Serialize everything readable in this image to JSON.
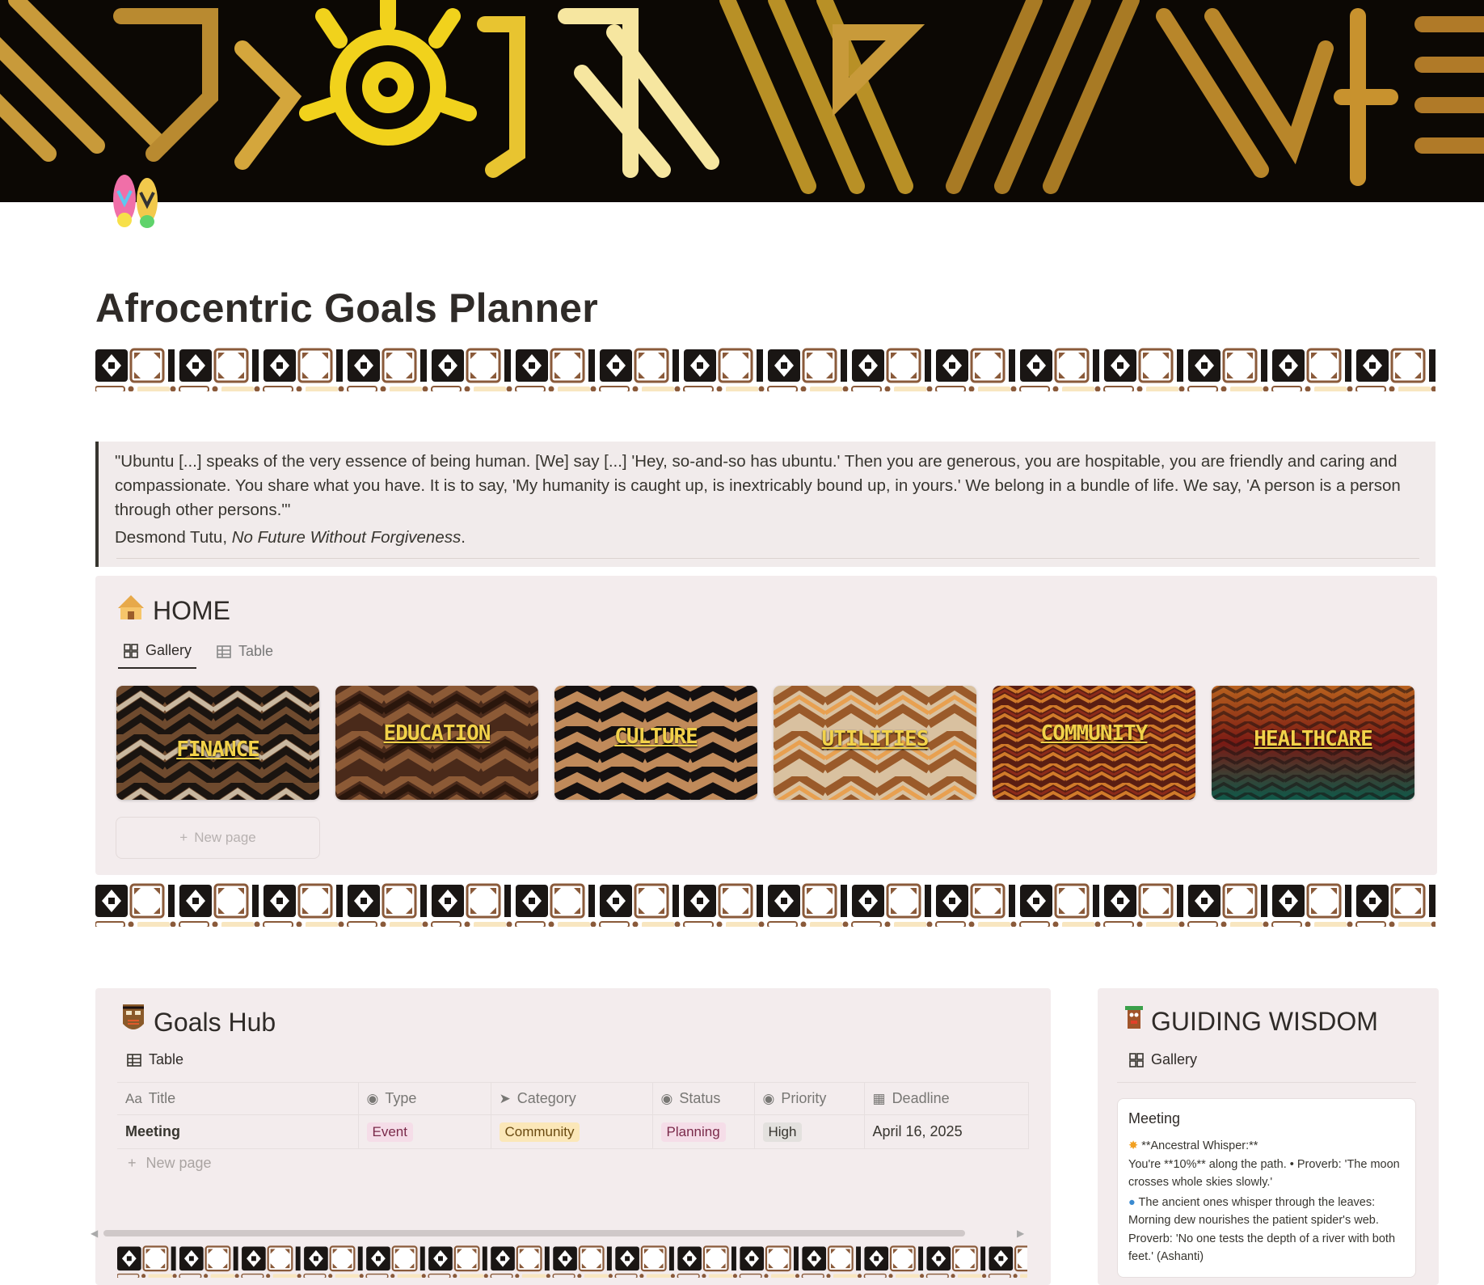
{
  "page": {
    "title": "Afrocentric Goals Planner",
    "icon": "flip-flops-icon"
  },
  "quote": {
    "text": "\"Ubuntu [...] speaks of the very essence of being human. [We] say [...] 'Hey, so-and-so has ubuntu.' Then you are generous, you are hospitable, you are friendly and caring and compassionate. You share what you have. It is to say, 'My humanity is caught up, is inextricably bound up, in yours.' We belong in a bundle of life. We say, 'A person is a person through other persons.'\"",
    "author": "Desmond Tutu, ",
    "source": "No Future Without Forgiveness",
    "end": "."
  },
  "home": {
    "title": "HOME",
    "tabs": [
      {
        "label": "Gallery",
        "active": true
      },
      {
        "label": "Table",
        "active": false
      }
    ],
    "cards": [
      "FINANCE",
      "EDUCATION",
      "CULTURE",
      "UTILITIES",
      "COMMUNITY",
      "HEALTHCARE"
    ],
    "new_page": "New page"
  },
  "goals": {
    "title": "Goals Hub",
    "view": "Table",
    "columns": [
      "Title",
      "Type",
      "Category",
      "Status",
      "Priority",
      "Deadline"
    ],
    "column_icons": [
      "Aa",
      "type-select-icon",
      "category-arrow-icon",
      "status-icon",
      "priority-icon",
      "calendar-icon"
    ],
    "rows": [
      {
        "title": "Meeting",
        "type": "Event",
        "category": "Community",
        "status": "Planning",
        "priority": "High",
        "deadline": "April 16, 2025"
      }
    ],
    "new_page": "New page"
  },
  "wisdom": {
    "title": "GUIDING WISDOM",
    "view": "Gallery",
    "card_title": "Meeting",
    "line1": "**Ancestral Whisper:**",
    "line2": "You're **10%** along the path. • Proverb: 'The moon crosses whole skies slowly.'",
    "line3": "The ancient ones whisper through the leaves: Morning dew nourishes the patient spider's web. Proverb: 'No one tests the depth of a river with both feet.' (Ashanti)"
  },
  "colors": {
    "panel": "#f3eced",
    "gold": "#f2d24a",
    "brown": "#7a4a2a",
    "tag_event": "#f5e0e9",
    "tag_community": "#fbecc4",
    "tag_planning": "#f5e0e9",
    "tag_high": "#e3e2e0"
  }
}
